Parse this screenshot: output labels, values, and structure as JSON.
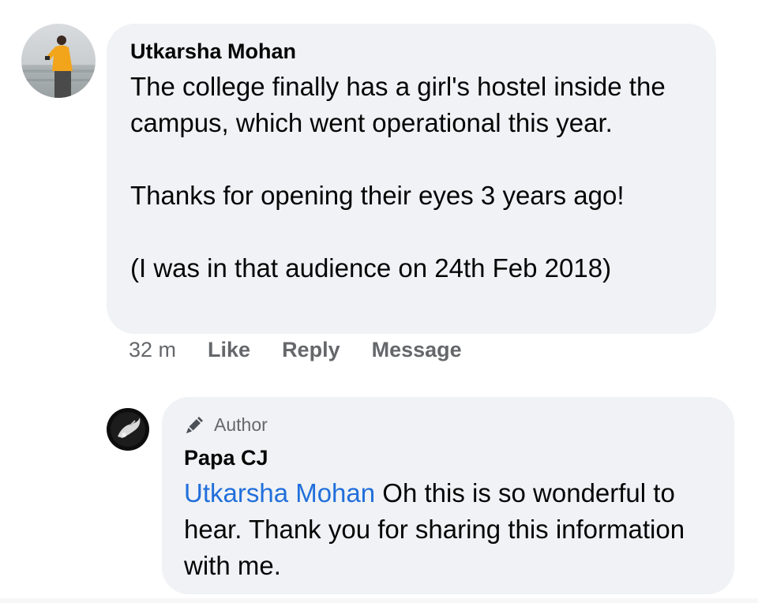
{
  "comment": {
    "author": "Utkarsha Mohan",
    "paragraphs": [
      "The college finally has a girl's hostel inside the campus, which went operational this year.",
      "Thanks for opening their eyes 3 years ago!",
      "(I was in that audience on 24th Feb 2018)"
    ],
    "time": "32 m",
    "like_label": "Like",
    "reply_label": "Reply",
    "message_label": "Message"
  },
  "reply": {
    "badge": "Author",
    "author": "Papa CJ",
    "mention": "Utkarsha Mohan",
    "text": " Oh this is so wonderful to hear. Thank you for sharing this information with me."
  },
  "icons": {
    "author_badge": "pen-icon"
  },
  "colors": {
    "bubble": "#f0f2f5",
    "mention": "#216fdb",
    "meta": "#65676b",
    "text": "#050505"
  }
}
